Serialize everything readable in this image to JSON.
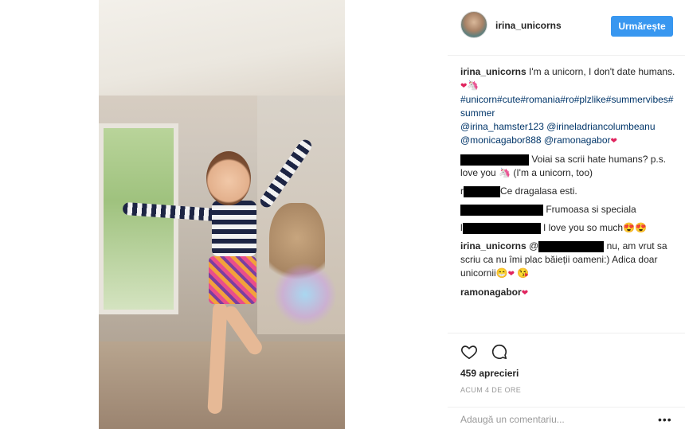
{
  "header": {
    "username": "irina_unicorns",
    "follow_label": "Urmărește"
  },
  "caption": {
    "username": "irina_unicorns",
    "text": "I'm a unicorn, I don't date humans.",
    "hashtags": "#unicorn#cute#romania#ro#plzlike#summervibes#summer",
    "mention_1": "@irina_hamster123",
    "mention_2": "@irineladriancolumbeanu",
    "mention_3": "@monicagabor888",
    "mention_4": "@ramonagabor"
  },
  "comments": [
    {
      "text": "Voiai sa scrii hate humans? p.s. love you",
      "text_tail": "(I'm a unicorn, too)"
    },
    {
      "prefix": "r",
      "text": "Ce dragalasa esti."
    },
    {
      "text": "Frumoasa si speciala"
    },
    {
      "prefix": "l",
      "text": "I love you so much"
    },
    {
      "username": "irina_unicorns",
      "prefix": "@",
      "text": "nu, am vrut sa scriu ca nu îmi plac băieții oameni:) Adica doar unicornii"
    },
    {
      "username": "ramonagabor"
    }
  ],
  "actions": {
    "heart_icon": "heart-outline-icon",
    "comment_icon": "comment-bubble-icon",
    "likes_label": "459 aprecieri",
    "time_label": "ACUM 4 DE ORE"
  },
  "add_comment": {
    "placeholder": "Adaugă un comentariu...",
    "more_label": "•••"
  },
  "colors": {
    "accent": "#3897f0",
    "tag": "#003569",
    "heart": "#e0245e"
  }
}
